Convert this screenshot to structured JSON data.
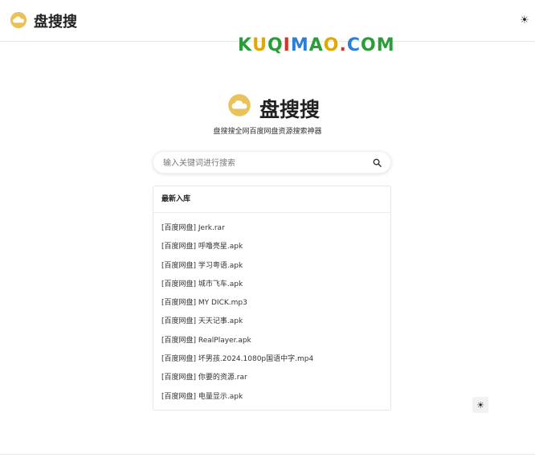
{
  "header": {
    "site_name": "盘搜搜",
    "theme_toggle_icon": "☀"
  },
  "banner": {
    "letters": [
      {
        "ch": "K",
        "color": "#2a9d3a"
      },
      {
        "ch": "U",
        "color": "#e0a800"
      },
      {
        "ch": "Q",
        "color": "#2a9d3a"
      },
      {
        "ch": "I",
        "color": "#d93025"
      },
      {
        "ch": "M",
        "color": "#2a7fd9"
      },
      {
        "ch": "A",
        "color": "#2a9d3a"
      },
      {
        "ch": "O",
        "color": "#e0a800"
      },
      {
        "ch": ".",
        "color": "#d93025"
      },
      {
        "ch": "C",
        "color": "#2a7fd9"
      },
      {
        "ch": "O",
        "color": "#2a9d3a"
      },
      {
        "ch": "M",
        "color": "#2a9d3a"
      }
    ]
  },
  "hero": {
    "title": "盘搜搜",
    "subtitle": "盘搜搜全网百度网盘资源搜索神器"
  },
  "search": {
    "placeholder": "输入关键词进行搜索",
    "value": ""
  },
  "latest": {
    "heading": "最新入库",
    "items": [
      "[百度网盘] Jerk.rar",
      "[百度网盘] 呼噜亮星.apk",
      "[百度网盘] 学习粤语.apk",
      "[百度网盘] 城市飞车.apk",
      "[百度网盘] MY DICK.mp3",
      "[百度网盘] 天天记事.apk",
      "[百度网盘] RealPlayer.apk",
      "[百度网盘] 坏男孩.2024.1080p国语中字.mp4",
      "[百度网盘] 你要的资源.rar",
      "[百度网盘] 电量显示.apk"
    ]
  },
  "floating": {
    "theme_toggle_icon": "☀"
  },
  "colors": {
    "cloud_logo": "#e8c25a",
    "border": "#e6e6e6"
  }
}
